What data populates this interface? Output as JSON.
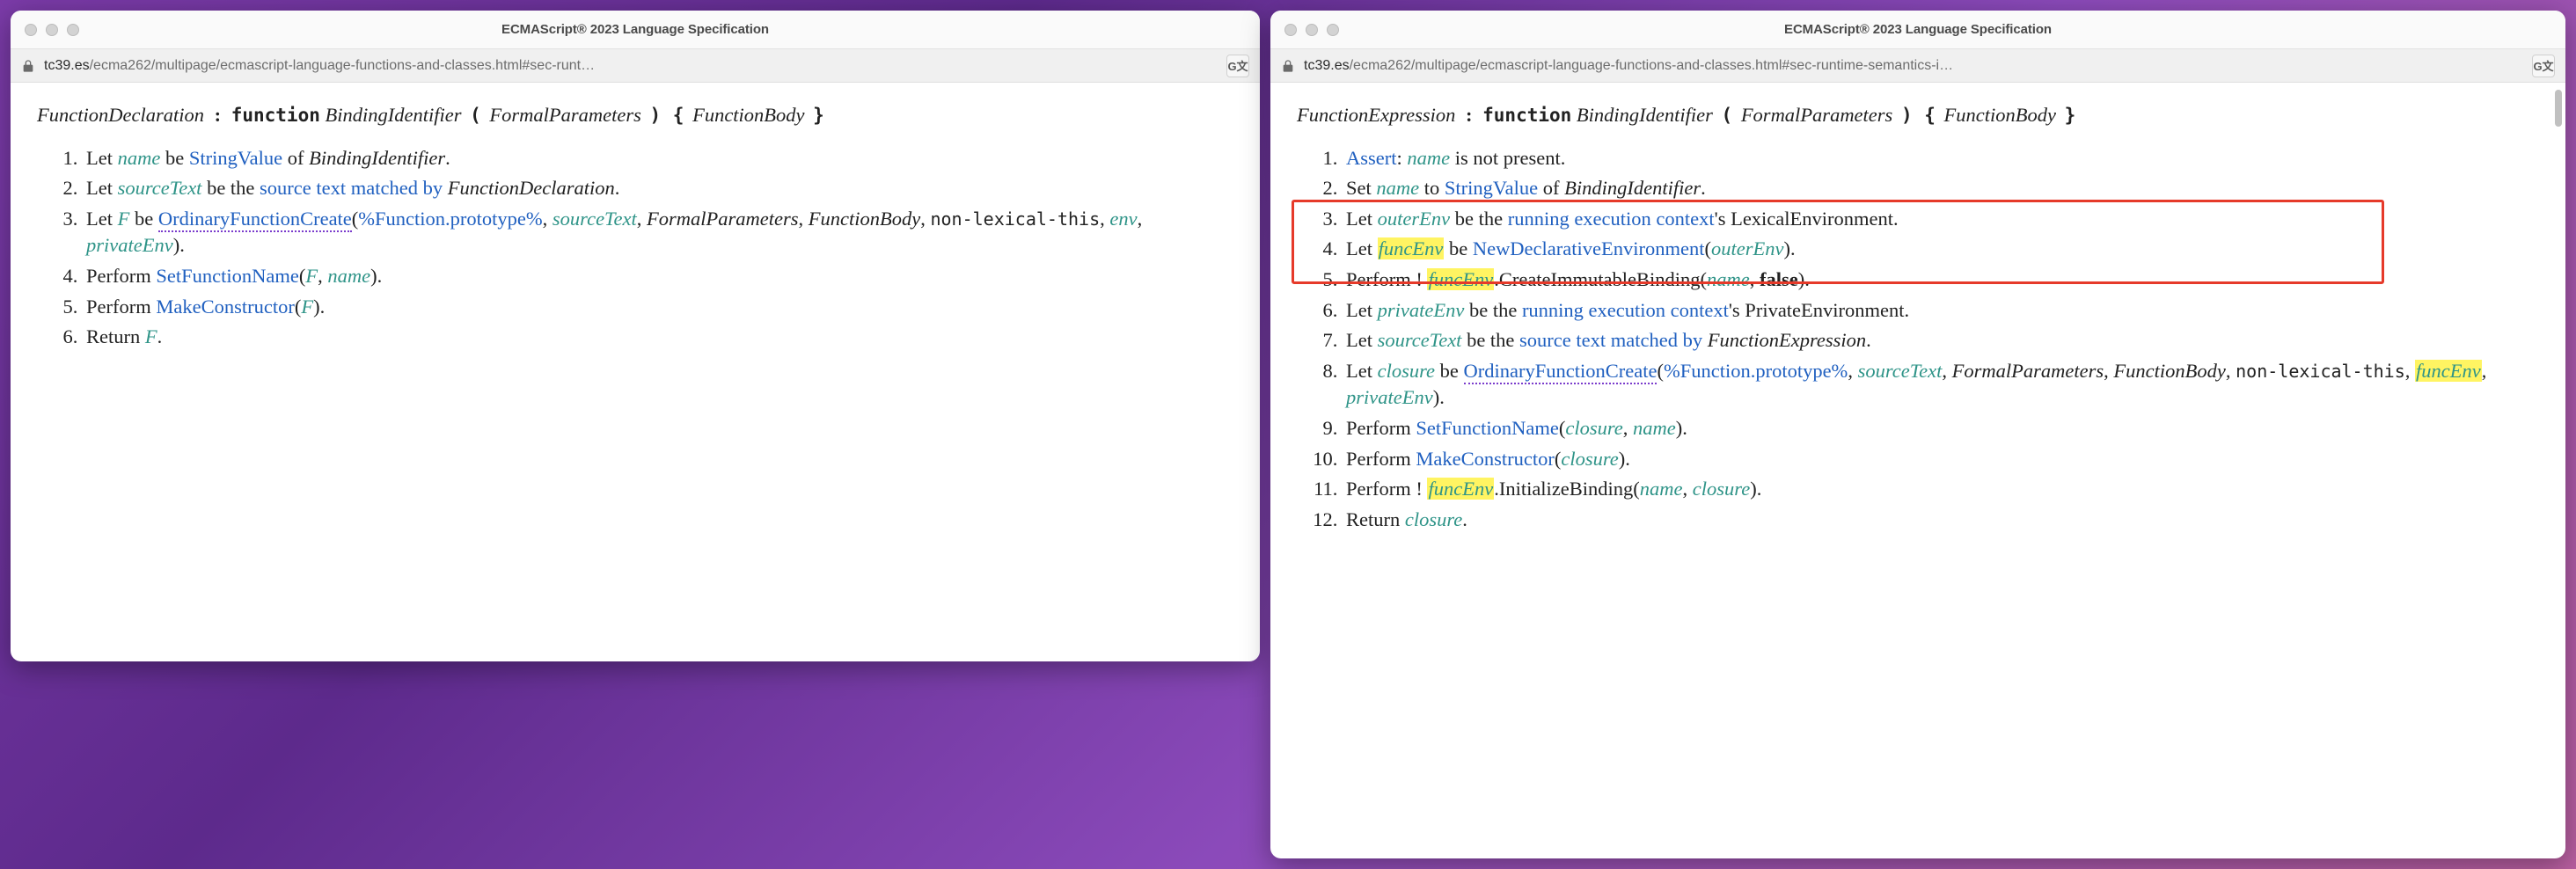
{
  "left": {
    "title": "ECMAScript® 2023 Language Specification",
    "url_host": "tc39.es",
    "url_path": "/ecma262/multipage/ecmascript-language-functions-and-classes.html#sec-runt…",
    "production": {
      "lhs": "FunctionDeclaration",
      "keyword": "function",
      "p1": "BindingIdentifier",
      "p2": "FormalParameters",
      "p3": "FunctionBody"
    },
    "steps": [
      {
        "pre": "Let ",
        "var1": "name",
        "mid1": " be ",
        "link1": "StringValue",
        "mid2": " of ",
        "ital1": "BindingIdentifier",
        "post": "."
      },
      {
        "pre": "Let ",
        "var1": "sourceText",
        "mid1": " be the ",
        "link1": "source text matched by",
        "mid2": " ",
        "ital1": "FunctionDeclaration",
        "post": "."
      },
      {
        "pre": "Let ",
        "var1": "F",
        "mid1": " be ",
        "link_wavy": "OrdinaryFunctionCreate",
        "args_open": "(",
        "link2": "%Function.prototype%",
        "c1": ", ",
        "var2": "sourceText",
        "c2": ", ",
        "ital2": "FormalParameters",
        "c3": ", ",
        "ital3": "FunctionBody",
        "c4": ", ",
        "mono1": "non-lexical-this",
        "c5": ", ",
        "var3": "env",
        "c6": ", ",
        "var4": "privateEnv",
        "args_close": ").",
        "wrap": true
      },
      {
        "pre": "Perform ",
        "link1": "SetFunctionName",
        "args_open": "(",
        "var1": "F",
        "c1": ", ",
        "var2": "name",
        "args_close": ")."
      },
      {
        "pre": "Perform ",
        "link1": "MakeConstructor",
        "args_open": "(",
        "var1": "F",
        "args_close": ")."
      },
      {
        "pre": "Return ",
        "var1": "F",
        "post": "."
      }
    ]
  },
  "right": {
    "title": "ECMAScript® 2023 Language Specification",
    "url_host": "tc39.es",
    "url_path": "/ecma262/multipage/ecmascript-language-functions-and-classes.html#sec-runtime-semantics-i…",
    "production": {
      "lhs": "FunctionExpression",
      "keyword": "function",
      "p1": "BindingIdentifier",
      "p2": "FormalParameters",
      "p3": "FunctionBody"
    },
    "steps": [
      {
        "link1": "Assert",
        "mid1": ": ",
        "var1": "name",
        "post": " is not present."
      },
      {
        "pre": "Set ",
        "var1": "name",
        "mid1": " to ",
        "link1": "StringValue",
        "mid2": " of ",
        "ital1": "BindingIdentifier",
        "post": "."
      },
      {
        "pre": "Let ",
        "var1": "outerEnv",
        "mid1": " be the ",
        "link1": "running execution context",
        "post": "'s LexicalEnvironment."
      },
      {
        "pre": "Let ",
        "hlvar1": "funcEnv",
        "mid1": " be ",
        "link1": "NewDeclarativeEnvironment",
        "args_open": "(",
        "var2": "outerEnv",
        "args_close": ")."
      },
      {
        "pre": "Perform ! ",
        "hlvar1": "funcEnv",
        "mid1": ".CreateImmutableBinding(",
        "var2": "name",
        "c1": ", ",
        "bold1": "false",
        "args_close": ")."
      },
      {
        "pre": "Let ",
        "var1": "privateEnv",
        "mid1": " be the ",
        "link1": "running execution context",
        "post": "'s PrivateEnvironment."
      },
      {
        "pre": "Let ",
        "var1": "sourceText",
        "mid1": " be the ",
        "link1": "source text matched by",
        "mid2": " ",
        "ital1": "FunctionExpression",
        "post": "."
      },
      {
        "pre": "Let ",
        "var1": "closure",
        "mid1": " be ",
        "link_wavy": "OrdinaryFunctionCreate",
        "args_open": "(",
        "link2": "%Function.prototype%",
        "c1": ", ",
        "var2": "sourceText",
        "c2": ", ",
        "ital2": "FormalParameters",
        "c3": ", ",
        "ital3": "FunctionBody",
        "c4": ", ",
        "mono1": "non-lexical-this",
        "c5": ", ",
        "hlvar2": "funcEnv",
        "c6": ", ",
        "var4": "privateEnv",
        "args_close": ").",
        "wrap": true
      },
      {
        "pre": "Perform ",
        "link1": "SetFunctionName",
        "args_open": "(",
        "var1": "closure",
        "c1": ", ",
        "var2": "name",
        "args_close": ")."
      },
      {
        "pre": "Perform ",
        "link1": "MakeConstructor",
        "args_open": "(",
        "var1": "closure",
        "args_close": ")."
      },
      {
        "pre": "Perform ! ",
        "hlvar1": "funcEnv",
        "mid1": ".InitializeBinding(",
        "var1": "name",
        "c1": ", ",
        "var2": "closure",
        "args_close": ")."
      },
      {
        "pre": "Return ",
        "var1": "closure",
        "post": "."
      }
    ]
  },
  "translate_label": "G文"
}
